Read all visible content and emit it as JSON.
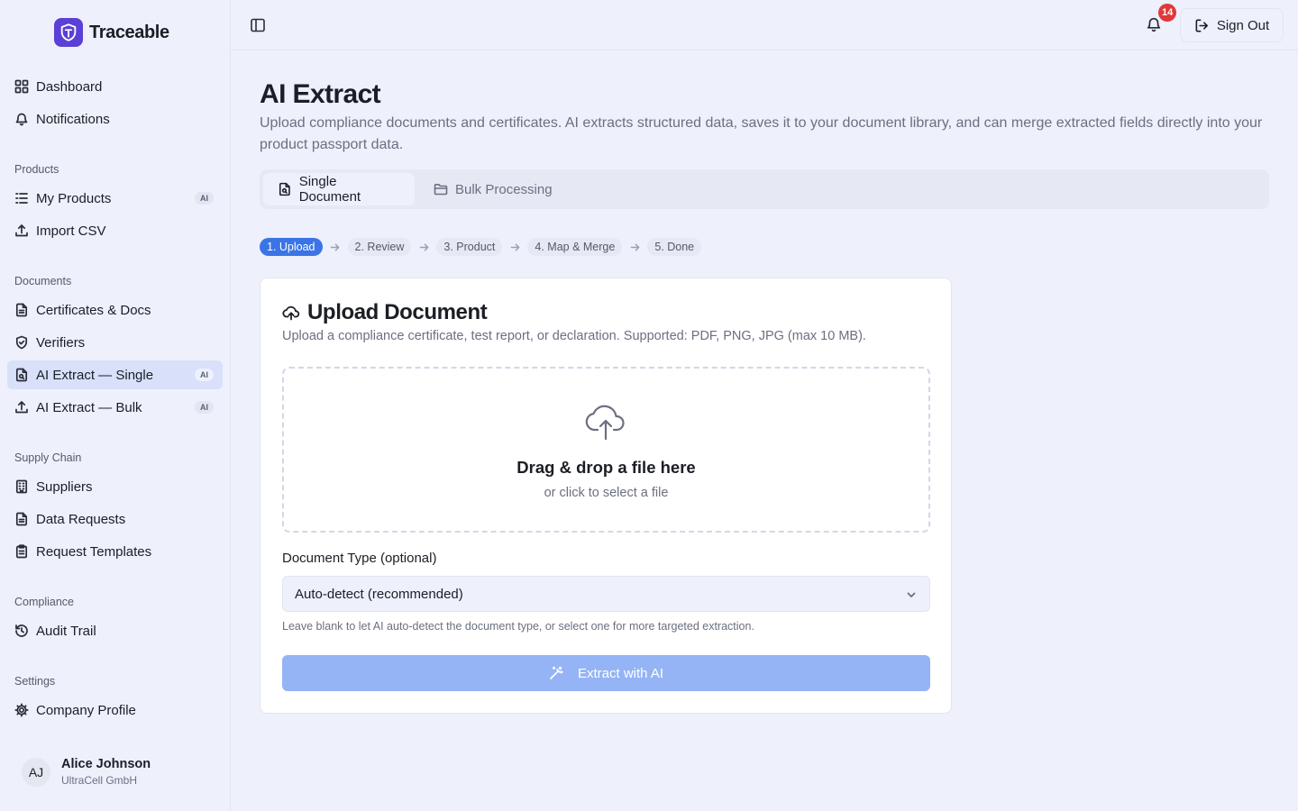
{
  "app": {
    "name": "Traceable"
  },
  "sidebar": {
    "top_items": [
      {
        "label": "Dashboard",
        "icon": "grid-icon"
      },
      {
        "label": "Notifications",
        "icon": "bell-icon"
      }
    ],
    "sections": {
      "products": {
        "label": "Products",
        "items": [
          {
            "label": "My Products",
            "icon": "list-icon",
            "badge": "AI"
          },
          {
            "label": "Import CSV",
            "icon": "upload-icon"
          }
        ]
      },
      "documents": {
        "label": "Documents",
        "items": [
          {
            "label": "Certificates & Docs",
            "icon": "file-text-icon"
          },
          {
            "label": "Verifiers",
            "icon": "shield-check-icon"
          },
          {
            "label": "AI Extract — Single",
            "icon": "file-scan-icon",
            "badge": "AI",
            "active": true
          },
          {
            "label": "AI Extract — Bulk",
            "icon": "upload-icon",
            "badge": "AI"
          }
        ]
      },
      "supply_chain": {
        "label": "Supply Chain",
        "items": [
          {
            "label": "Suppliers",
            "icon": "building-icon"
          },
          {
            "label": "Data Requests",
            "icon": "file-text-icon"
          },
          {
            "label": "Request Templates",
            "icon": "clipboard-icon"
          }
        ]
      },
      "compliance": {
        "label": "Compliance",
        "items": [
          {
            "label": "Audit Trail",
            "icon": "history-icon"
          }
        ]
      },
      "settings": {
        "label": "Settings",
        "items": [
          {
            "label": "Company Profile",
            "icon": "gear-icon"
          }
        ]
      }
    },
    "user": {
      "initials": "AJ",
      "name": "Alice Johnson",
      "org": "UltraCell GmbH"
    }
  },
  "header": {
    "notification_count": "14",
    "sign_out_label": "Sign Out"
  },
  "main": {
    "title": "AI Extract",
    "description": "Upload compliance documents and certificates. AI extracts structured data, saves it to your document library, and can merge extracted fields directly into your product passport data.",
    "tabs": [
      {
        "label": "Single Document",
        "icon": "file-icon",
        "active": true
      },
      {
        "label": "Bulk Processing",
        "icon": "folder-icon",
        "active": false
      }
    ],
    "steps": [
      {
        "label": "1. Upload",
        "current": true
      },
      {
        "label": "2. Review"
      },
      {
        "label": "3. Product"
      },
      {
        "label": "4. Map & Merge"
      },
      {
        "label": "5. Done"
      }
    ],
    "card": {
      "title": "Upload Document",
      "description": "Upload a compliance certificate, test report, or declaration. Supported: PDF, PNG, JPG (max 10 MB).",
      "dropzone_title": "Drag & drop a file here",
      "dropzone_subtitle": "or click to select a file",
      "doc_type_label": "Document Type (optional)",
      "doc_type_value": "Auto-detect (recommended)",
      "doc_type_hint": "Leave blank to let AI auto-detect the document type, or select one for more targeted extraction.",
      "extract_button": "Extract with AI"
    }
  },
  "colors": {
    "brand": "#5b3fd6",
    "accent": "#3b74e6",
    "active_nav": "#d8e0fa",
    "button_disabled": "#95b4f5",
    "notification_badge": "#e0393a"
  }
}
